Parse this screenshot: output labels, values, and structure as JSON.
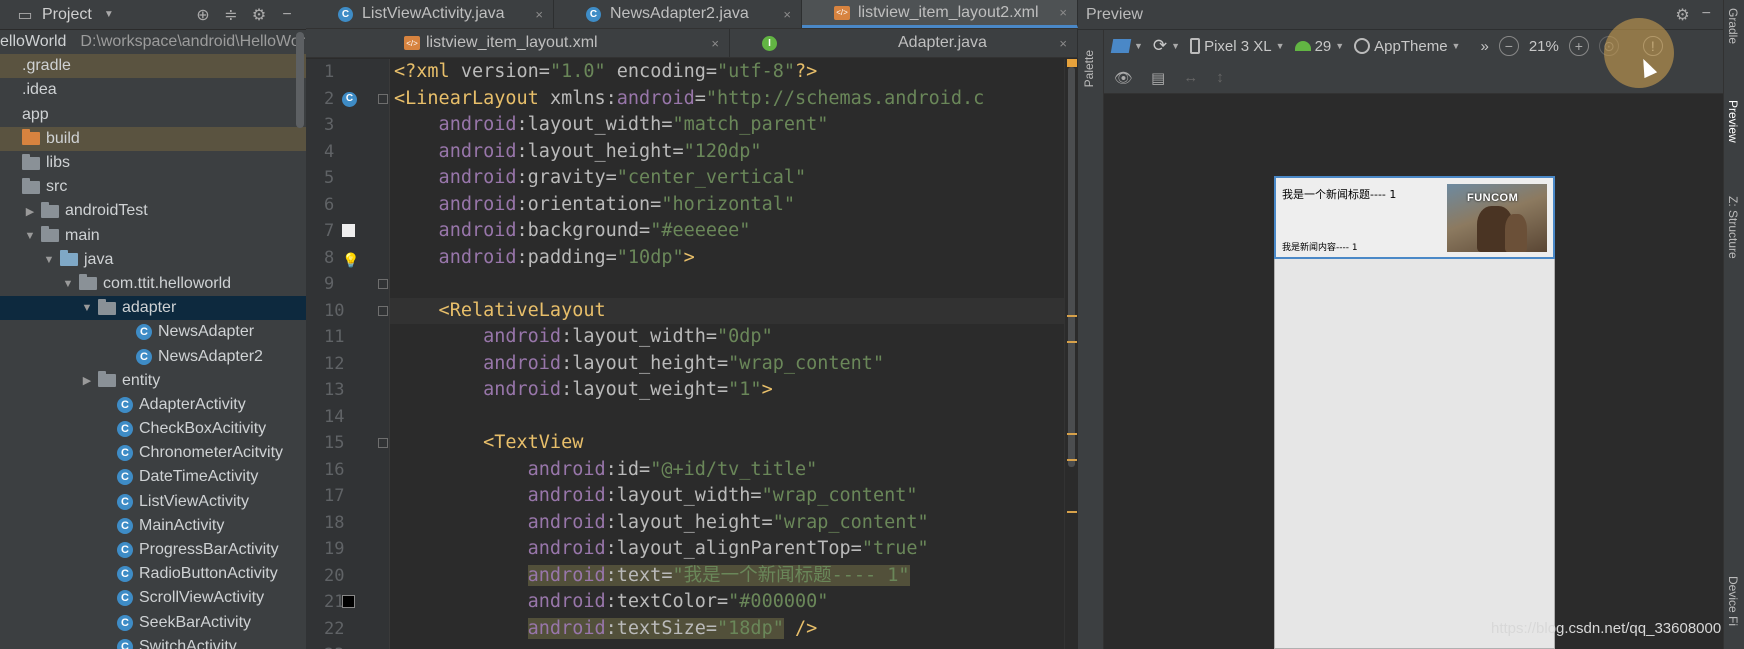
{
  "project": {
    "title": "Project",
    "root_name": "elloWorld",
    "root_path": "D:\\workspace\\android\\HelloWor",
    "tree": [
      {
        "label": ".gradle",
        "indent": 0,
        "icon": "none",
        "state": "hl"
      },
      {
        "label": ".idea",
        "indent": 0,
        "icon": "none",
        "state": ""
      },
      {
        "label": "app",
        "indent": 0,
        "icon": "none",
        "state": ""
      },
      {
        "label": "build",
        "indent": 0,
        "icon": "folder-orange",
        "state": "hl"
      },
      {
        "label": "libs",
        "indent": 0,
        "icon": "folder",
        "state": ""
      },
      {
        "label": "src",
        "indent": 0,
        "icon": "folder",
        "state": ""
      },
      {
        "label": "androidTest",
        "indent": 1,
        "icon": "folder",
        "arrow": "▶",
        "state": ""
      },
      {
        "label": "main",
        "indent": 1,
        "icon": "folder",
        "arrow": "▼",
        "state": ""
      },
      {
        "label": "java",
        "indent": 2,
        "icon": "folder-blue",
        "arrow": "▼",
        "state": ""
      },
      {
        "label": "com.ttit.helloworld",
        "indent": 3,
        "icon": "folder",
        "arrow": "▼",
        "state": ""
      },
      {
        "label": "adapter",
        "indent": 4,
        "icon": "folder",
        "arrow": "▼",
        "state": "selected"
      },
      {
        "label": "NewsAdapter",
        "indent": 6,
        "icon": "class",
        "state": ""
      },
      {
        "label": "NewsAdapter2",
        "indent": 6,
        "icon": "class",
        "state": ""
      },
      {
        "label": "entity",
        "indent": 4,
        "icon": "folder",
        "arrow": "▶",
        "state": ""
      },
      {
        "label": "AdapterActivity",
        "indent": 5,
        "icon": "class",
        "state": ""
      },
      {
        "label": "CheckBoxAcitivity",
        "indent": 5,
        "icon": "class",
        "state": ""
      },
      {
        "label": "ChronometerAcitvity",
        "indent": 5,
        "icon": "class",
        "state": ""
      },
      {
        "label": "DateTimeActivity",
        "indent": 5,
        "icon": "class",
        "state": ""
      },
      {
        "label": "ListViewActivity",
        "indent": 5,
        "icon": "class",
        "state": ""
      },
      {
        "label": "MainActivity",
        "indent": 5,
        "icon": "class",
        "state": ""
      },
      {
        "label": "ProgressBarActivity",
        "indent": 5,
        "icon": "class",
        "state": ""
      },
      {
        "label": "RadioButtonActivity",
        "indent": 5,
        "icon": "class",
        "state": ""
      },
      {
        "label": "ScrollViewActivity",
        "indent": 5,
        "icon": "class",
        "state": ""
      },
      {
        "label": "SeekBarActivity",
        "indent": 5,
        "icon": "class",
        "state": ""
      },
      {
        "label": "SwitchActivity",
        "indent": 5,
        "icon": "class",
        "state": ""
      }
    ]
  },
  "editor": {
    "tabs_row1": [
      {
        "label": "ListViewActivity.java",
        "icon": "c",
        "close": "×",
        "active": false
      },
      {
        "label": "NewsAdapter2.java",
        "icon": "c",
        "close": "×",
        "active": false
      },
      {
        "label": "listview_item_layout2.xml",
        "icon": "xml",
        "close": "×",
        "active": true
      }
    ],
    "tabs_row2": [
      {
        "label": "listview_item_layout.xml",
        "icon": "xml",
        "close": "×",
        "active": false
      },
      {
        "label": "Adapter.java",
        "icon": "g",
        "close": "×",
        "active": false
      }
    ],
    "line_numbers": [
      "1",
      "2",
      "3",
      "4",
      "5",
      "6",
      "7",
      "8",
      "9",
      "10",
      "11",
      "12",
      "13",
      "14",
      "15",
      "16",
      "17",
      "18",
      "19",
      "20",
      "21",
      "22",
      "23"
    ],
    "code_lines": [
      [
        {
          "t": "<?xml ",
          "c": "decl"
        },
        {
          "t": "version",
          "c": "attr"
        },
        {
          "t": "=",
          "c": "attr"
        },
        {
          "t": "\"1.0\"",
          "c": "str"
        },
        {
          "t": " encoding",
          "c": "attr"
        },
        {
          "t": "=",
          "c": "attr"
        },
        {
          "t": "\"utf-8\"",
          "c": "str"
        },
        {
          "t": "?>",
          "c": "decl"
        }
      ],
      [
        {
          "t": "<LinearLayout ",
          "c": "tag"
        },
        {
          "t": "xmlns:",
          "c": "attr"
        },
        {
          "t": "android",
          "c": "ns"
        },
        {
          "t": "=",
          "c": "attr"
        },
        {
          "t": "\"http://schemas.android.c",
          "c": "str"
        }
      ],
      [
        {
          "t": "    android",
          "c": "ns"
        },
        {
          "t": ":layout_width=",
          "c": "attr"
        },
        {
          "t": "\"match_parent\"",
          "c": "str"
        }
      ],
      [
        {
          "t": "    android",
          "c": "ns"
        },
        {
          "t": ":layout_height=",
          "c": "attr"
        },
        {
          "t": "\"120dp\"",
          "c": "str"
        }
      ],
      [
        {
          "t": "    android",
          "c": "ns"
        },
        {
          "t": ":gravity=",
          "c": "attr"
        },
        {
          "t": "\"center_vertical\"",
          "c": "str"
        }
      ],
      [
        {
          "t": "    android",
          "c": "ns"
        },
        {
          "t": ":orientation=",
          "c": "attr"
        },
        {
          "t": "\"horizontal\"",
          "c": "str"
        }
      ],
      [
        {
          "t": "    android",
          "c": "ns"
        },
        {
          "t": ":background=",
          "c": "attr"
        },
        {
          "t": "\"#eeeeee\"",
          "c": "str"
        }
      ],
      [
        {
          "t": "    android",
          "c": "ns"
        },
        {
          "t": ":padding=",
          "c": "attr"
        },
        {
          "t": "\"10dp\"",
          "c": "str"
        },
        {
          "t": ">",
          "c": "tag"
        }
      ],
      [
        {
          "t": "",
          "c": "attr"
        }
      ],
      [
        {
          "t": "    <RelativeLayout",
          "c": "tag"
        }
      ],
      [
        {
          "t": "        android",
          "c": "ns"
        },
        {
          "t": ":layout_width=",
          "c": "attr"
        },
        {
          "t": "\"0dp\"",
          "c": "str"
        }
      ],
      [
        {
          "t": "        android",
          "c": "ns"
        },
        {
          "t": ":layout_height=",
          "c": "attr"
        },
        {
          "t": "\"wrap_content\"",
          "c": "str"
        }
      ],
      [
        {
          "t": "        android",
          "c": "ns"
        },
        {
          "t": ":layout_weight=",
          "c": "attr"
        },
        {
          "t": "\"1\"",
          "c": "str"
        },
        {
          "t": ">",
          "c": "tag"
        }
      ],
      [
        {
          "t": "",
          "c": "attr"
        }
      ],
      [
        {
          "t": "        <TextView",
          "c": "tag"
        }
      ],
      [
        {
          "t": "            android",
          "c": "ns"
        },
        {
          "t": ":id=",
          "c": "attr"
        },
        {
          "t": "\"@+id/tv_title\"",
          "c": "str"
        }
      ],
      [
        {
          "t": "            android",
          "c": "ns"
        },
        {
          "t": ":layout_width=",
          "c": "attr"
        },
        {
          "t": "\"wrap_content\"",
          "c": "str"
        }
      ],
      [
        {
          "t": "            android",
          "c": "ns"
        },
        {
          "t": ":layout_height=",
          "c": "attr"
        },
        {
          "t": "\"wrap_content\"",
          "c": "str"
        }
      ],
      [
        {
          "t": "            android",
          "c": "ns"
        },
        {
          "t": ":layout_alignParentTop=",
          "c": "attr"
        },
        {
          "t": "\"true\"",
          "c": "str"
        }
      ],
      [
        {
          "t": "            ",
          "c": "attr"
        },
        {
          "t": "android",
          "c": "ns",
          "hl": true
        },
        {
          "t": ":text=",
          "c": "attr",
          "hl": true
        },
        {
          "t": "\"我是一个新闻标题---- 1\"",
          "c": "str",
          "hl": true
        }
      ],
      [
        {
          "t": "            android",
          "c": "ns"
        },
        {
          "t": ":textColor=",
          "c": "attr"
        },
        {
          "t": "\"#000000\"",
          "c": "str"
        }
      ],
      [
        {
          "t": "            ",
          "c": "attr"
        },
        {
          "t": "android",
          "c": "ns",
          "hl": true
        },
        {
          "t": ":textSize=",
          "c": "attr",
          "hl": true
        },
        {
          "t": "\"18dp\"",
          "c": "str",
          "hl": true
        },
        {
          "t": " />",
          "c": "tag"
        }
      ],
      [
        {
          "t": "",
          "c": "attr"
        }
      ]
    ],
    "current_line": 9
  },
  "preview": {
    "title": "Preview",
    "palette_label": "Palette",
    "device": "Pixel 3 XL",
    "api": "29",
    "theme": "AppTheme",
    "zoom": "21%",
    "more": "»",
    "item_title": "我是一个新闻标题---- 1",
    "item_content": "我是新闻内容---- 1",
    "image_brand": "FUNCOM"
  },
  "right_strip": {
    "gradle": "Gradle",
    "preview": "Preview",
    "structure": "Z: Structure",
    "device": "Device Fi"
  },
  "watermark": "https://blog.csdn.net/qq_33608000",
  "colors": {
    "accent": "#4a88c7",
    "selection": "#0d293e",
    "xml_tag": "#e8bf6a",
    "xml_ns": "#9876aa",
    "xml_string": "#6a8759"
  }
}
